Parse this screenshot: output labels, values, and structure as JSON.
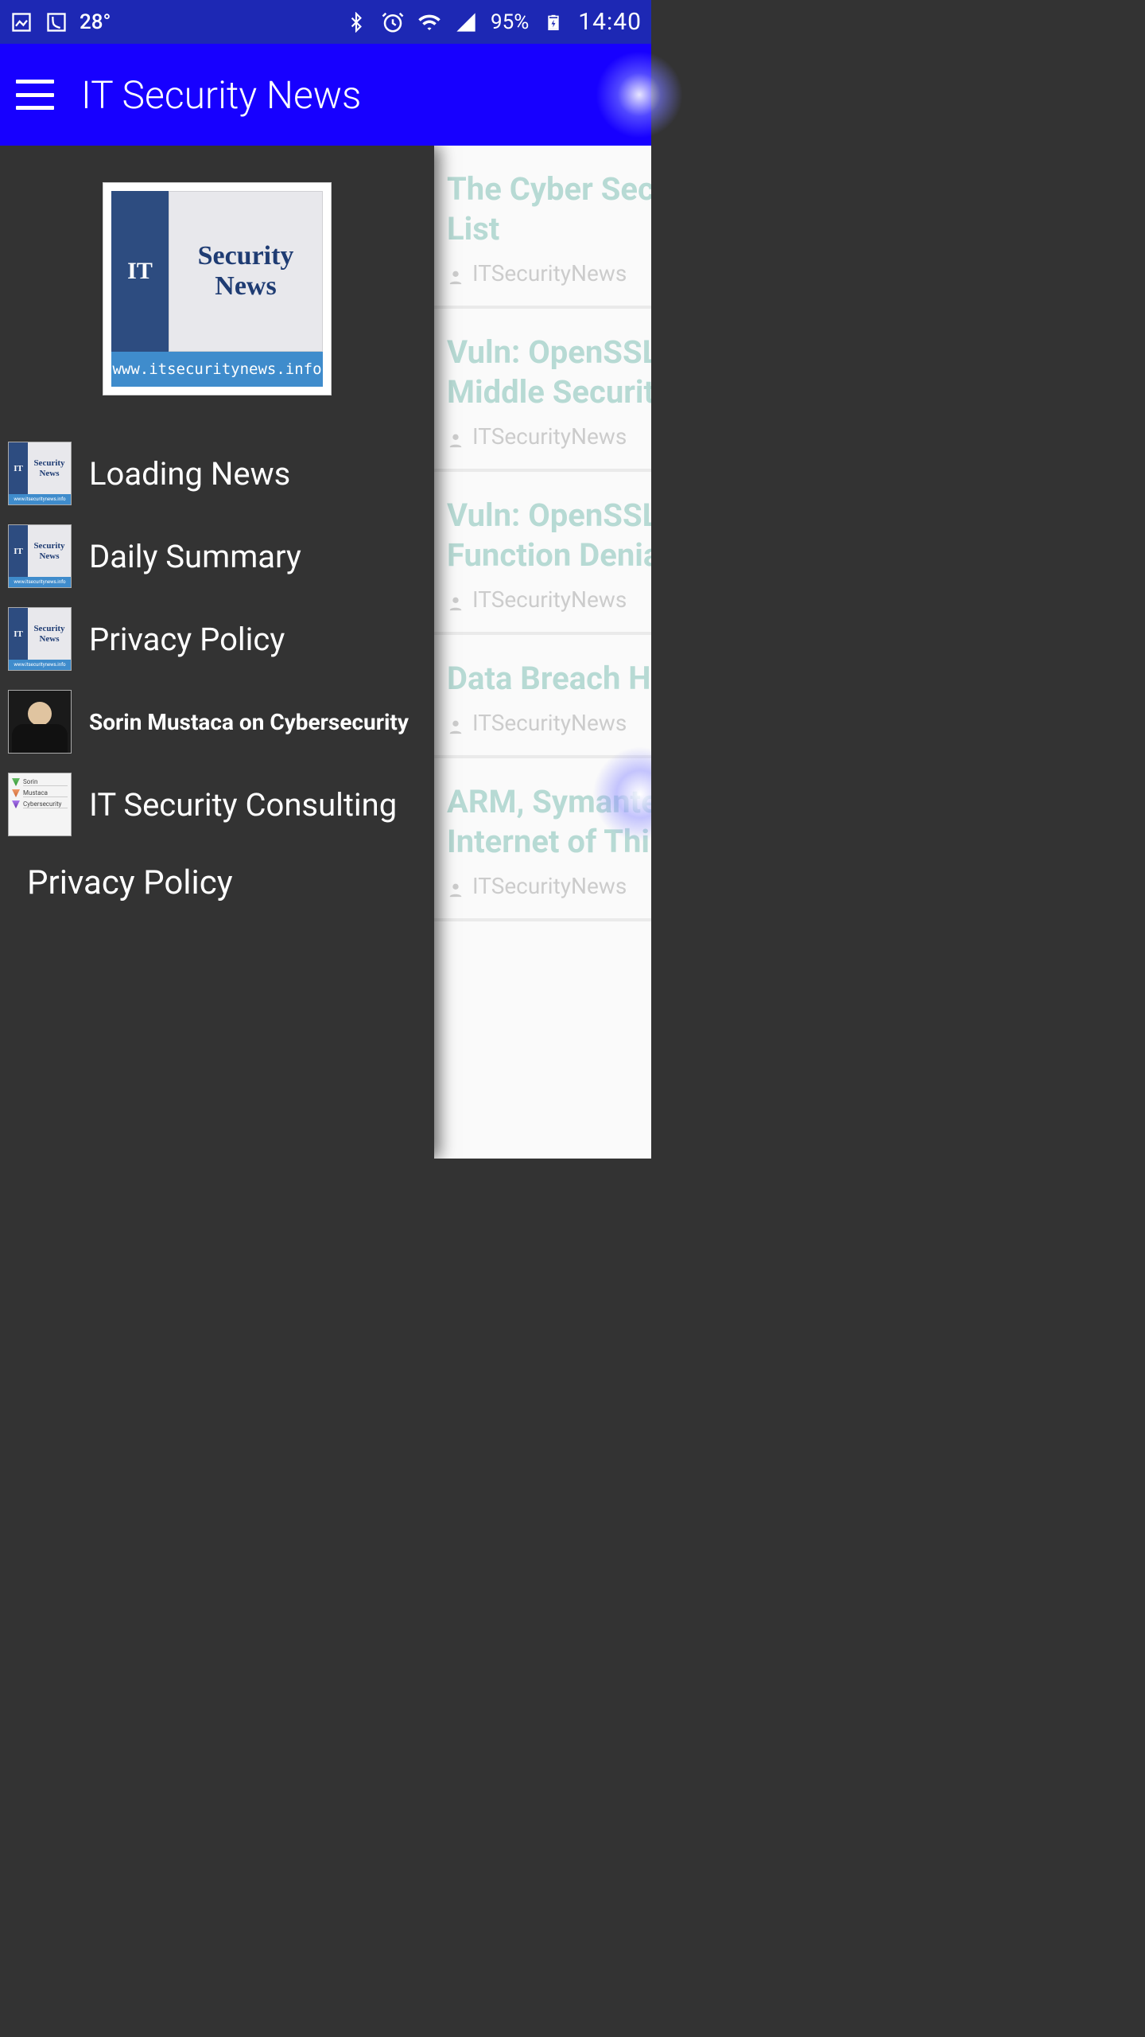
{
  "status_bar": {
    "temp": "28°",
    "battery": "95%",
    "time": "14:40"
  },
  "app_bar": {
    "title": "IT Security News"
  },
  "drawer": {
    "logo": {
      "it": "IT",
      "line1": "Security",
      "line2": "News",
      "url": "www.itsecuritynews.info"
    },
    "items": [
      {
        "label": "Loading News",
        "thumb": "logo",
        "cls": "big"
      },
      {
        "label": "Daily Summary",
        "thumb": "logo",
        "cls": "big"
      },
      {
        "label": "Privacy Policy",
        "thumb": "logo",
        "cls": "big"
      },
      {
        "label": "Sorin Mustaca on Cybersecurity",
        "thumb": "person",
        "cls": "small"
      },
      {
        "label": "IT Security Consulting",
        "thumb": "list",
        "cls": "big"
      }
    ],
    "footer_label": "Privacy Policy",
    "thumb_list_rows": [
      "Sorin",
      "Mustaca",
      "Cybersecurity"
    ]
  },
  "news": {
    "author": "ITSecurityNews",
    "items": [
      {
        "title_l1": "The Cyber Sec",
        "title_l2": "List"
      },
      {
        "title_l1": "Vuln: OpenSSL",
        "title_l2": "Middle Securit"
      },
      {
        "title_l1": "Vuln: OpenSSL",
        "title_l2": "Function Denia"
      },
      {
        "title_l1": "Data Breach H",
        "title_l2": ""
      },
      {
        "title_l1": "ARM, Symante",
        "title_l2": "Internet of Thi"
      }
    ]
  }
}
